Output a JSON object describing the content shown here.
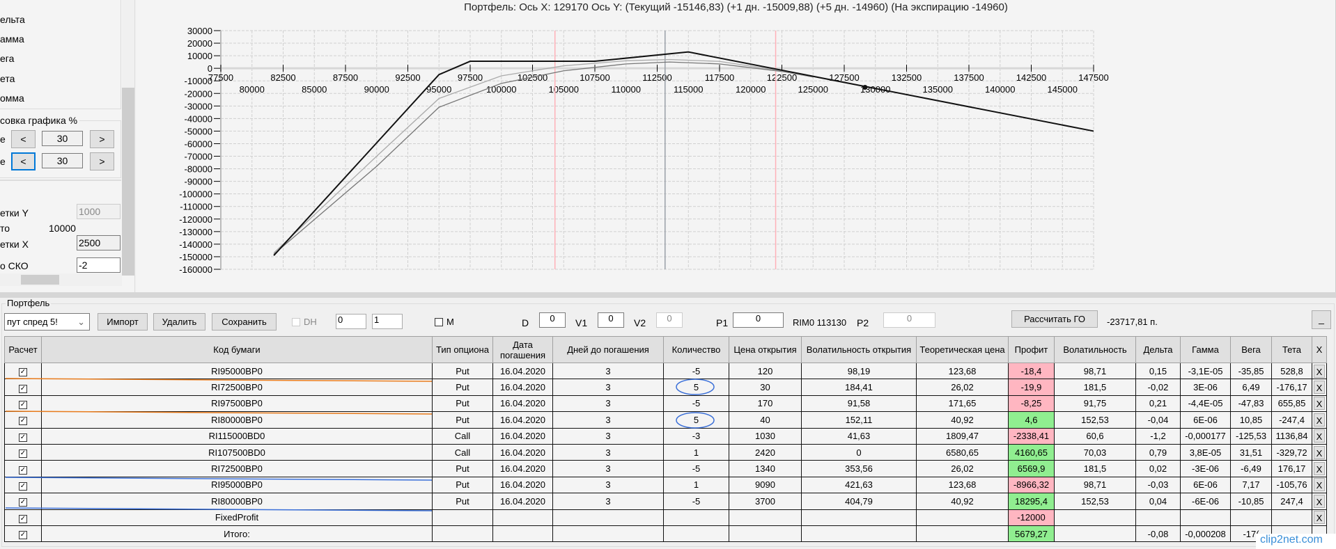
{
  "left_panel": {
    "items": [
      "ельта",
      "амма",
      "ега",
      "ета",
      "омма"
    ],
    "group_title": "совка графика %",
    "row1_label": "е",
    "row1_value": "30",
    "row2_label": "е",
    "row2_value": "30",
    "prev": "<",
    "next": ">",
    "grid_y_label": "етки Y",
    "grid_y_value": "1000",
    "total_label": "то",
    "total_value": "10000",
    "grid_x_label": "етки X",
    "grid_x_value": "2500",
    "sko_label": "о СКО",
    "sko_value": "-2"
  },
  "chart_title": "Портфель: Ось X: 129170 Ось Y:  (Текущий -15146,83)  (+1 дн. -15009,88)  (+5 дн. -14960)  (На экспирацию -14960)",
  "chart_data": {
    "type": "line",
    "xlim": [
      77500,
      147500
    ],
    "ylim": [
      -160000,
      30000
    ],
    "x_ticks_top": [
      "77500",
      "82500",
      "87500",
      "92500",
      "97500",
      "102500",
      "107500",
      "112500",
      "117500",
      "122500",
      "127500",
      "132500",
      "137500",
      "142500",
      "147500"
    ],
    "x_ticks_bottom": [
      "80000",
      "85000",
      "90000",
      "95000",
      "100000",
      "105000",
      "110000",
      "115000",
      "120000",
      "125000",
      "130000",
      "135000",
      "140000",
      "145000"
    ],
    "y_ticks": [
      "30000",
      "20000",
      "10000",
      "0",
      "-10000",
      "-20000",
      "-30000",
      "-40000",
      "-50000",
      "-60000",
      "-70000",
      "-80000",
      "-90000",
      "-100000",
      "-110000",
      "-120000",
      "-130000",
      "-140000",
      "-150000",
      "-160000"
    ],
    "grid": true,
    "current_price_line": 113130,
    "range_lines": [
      104300,
      122000
    ],
    "marker": {
      "x": 129170,
      "y": -15146.83
    },
    "series": [
      {
        "color": "#111111",
        "points": [
          [
            81750,
            -149000
          ],
          [
            95000,
            -5000
          ],
          [
            97500,
            5600
          ],
          [
            107500,
            5600
          ],
          [
            115000,
            13000
          ],
          [
            147500,
            -50000
          ]
        ]
      },
      {
        "color": "#aaaaaa",
        "points": [
          [
            81750,
            -147000
          ],
          [
            90000,
            -70000
          ],
          [
            95000,
            -24000
          ],
          [
            100000,
            -6000
          ],
          [
            105000,
            2000
          ],
          [
            110000,
            6000
          ],
          [
            113500,
            7000
          ],
          [
            117500,
            5500
          ],
          [
            122500,
            -2000
          ],
          [
            125000,
            -7000
          ]
        ]
      },
      {
        "color": "#777777",
        "points": [
          [
            81750,
            -148000
          ],
          [
            90000,
            -78000
          ],
          [
            95000,
            -31000
          ],
          [
            100000,
            -12000
          ],
          [
            105000,
            -2000
          ],
          [
            110000,
            3500
          ],
          [
            113500,
            5000
          ],
          [
            117500,
            3500
          ],
          [
            122500,
            -2500
          ],
          [
            125000,
            -7000
          ]
        ]
      }
    ]
  },
  "portfolio": {
    "title": "Портфель",
    "select_value": "пут спред 5!",
    "import": "Импорт",
    "delete": "Удалить",
    "save": "Сохранить",
    "dh": "DH",
    "spin1": "0",
    "spin2": "1",
    "m": "M",
    "d_label": "D",
    "d_value": "0",
    "v1_label": "V1",
    "v1_value": "0",
    "v2_label": "V2",
    "v2_value": "0",
    "p1_label": "P1",
    "p1_value": "0",
    "rim": "RIM0 113130",
    "p2_label": "P2",
    "p2_value": "0",
    "calc_go": "Рассчитать ГО",
    "go_value": "-23717,81 п.",
    "min": "_"
  },
  "table": {
    "headers": [
      "Расчет",
      "Код бумаги",
      "Тип опциона",
      "Дата погашения",
      "Дней до погашения",
      "Количество",
      "Цена открытия",
      "Волатильность открытия",
      "Теоретическая цена",
      "Профит",
      "Волатильность",
      "Дельта",
      "Гамма",
      "Вега",
      "Тета",
      "X"
    ],
    "rows": [
      [
        "☑",
        "RI95000BP0",
        "Put",
        "16.04.2020",
        "3",
        "-5",
        "120",
        "98,19",
        "123,68",
        "-18,4",
        "98,71",
        "0,15",
        "-3,1E-05",
        "-35,85",
        "528,8",
        "X"
      ],
      [
        "☑",
        "RI72500BP0",
        "Put",
        "16.04.2020",
        "3",
        "5",
        "30",
        "184,41",
        "26,02",
        "-19,9",
        "181,5",
        "-0,02",
        "3E-06",
        "6,49",
        "-176,17",
        "X"
      ],
      [
        "☑",
        "RI97500BP0",
        "Put",
        "16.04.2020",
        "3",
        "-5",
        "170",
        "91,58",
        "171,65",
        "-8,25",
        "91,75",
        "0,21",
        "-4,4E-05",
        "-47,83",
        "655,85",
        "X"
      ],
      [
        "☑",
        "RI80000BP0",
        "Put",
        "16.04.2020",
        "3",
        "5",
        "40",
        "152,11",
        "40,92",
        "4,6",
        "152,53",
        "-0,04",
        "6E-06",
        "10,85",
        "-247,4",
        "X"
      ],
      [
        "☑",
        "RI115000BD0",
        "Call",
        "16.04.2020",
        "3",
        "-3",
        "1030",
        "41,63",
        "1809,47",
        "-2338,41",
        "60,6",
        "-1,2",
        "-0,000177",
        "-125,53",
        "1136,84",
        "X"
      ],
      [
        "☑",
        "RI107500BD0",
        "Call",
        "16.04.2020",
        "3",
        "1",
        "2420",
        "0",
        "6580,65",
        "4160,65",
        "70,03",
        "0,79",
        "3,8E-05",
        "31,51",
        "-329,72",
        "X"
      ],
      [
        "☑",
        "RI72500BP0",
        "Put",
        "16.04.2020",
        "3",
        "-5",
        "1340",
        "353,56",
        "26,02",
        "6569,9",
        "181,5",
        "0,02",
        "-3E-06",
        "-6,49",
        "176,17",
        "X"
      ],
      [
        "☑",
        "RI95000BP0",
        "Put",
        "16.04.2020",
        "3",
        "1",
        "9090",
        "421,63",
        "123,68",
        "-8966,32",
        "98,71",
        "-0,03",
        "6E-06",
        "7,17",
        "-105,76",
        "X"
      ],
      [
        "☑",
        "RI80000BP0",
        "Put",
        "16.04.2020",
        "3",
        "-5",
        "3700",
        "404,79",
        "40,92",
        "18295,4",
        "152,53",
        "0,04",
        "-6E-06",
        "-10,85",
        "247,4",
        "X"
      ],
      [
        "☑",
        "FixedProfit",
        "",
        "",
        "",
        "",
        "",
        "",
        "",
        "-12000",
        "",
        "",
        "",
        "",
        "",
        "X"
      ],
      [
        "☑",
        "Итого:",
        "",
        "",
        "",
        "",
        "",
        "",
        "",
        "5679,27",
        "",
        "-0,08",
        "-0,000208",
        "-17(",
        "",
        ""
      ]
    ]
  },
  "watermark": "clip2net.com",
  "colors": {
    "profit_neg": "#ffb6c1",
    "profit_pos": "#90ee90",
    "range_line": "#ffb0b8",
    "price_line": "#9aa0a8"
  }
}
